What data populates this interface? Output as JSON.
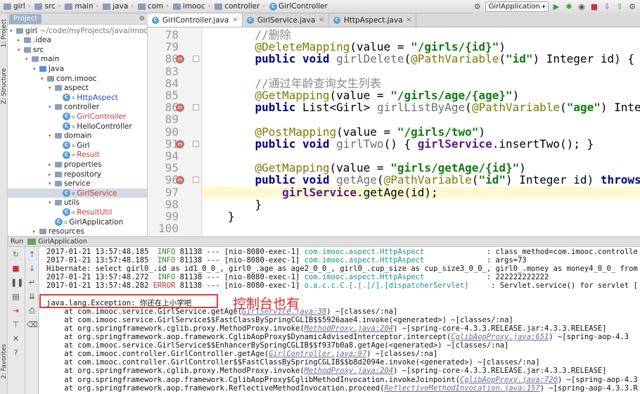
{
  "breadcrumbs": [
    "girl",
    "src",
    "main",
    "java",
    "com",
    "imooc",
    "controller",
    "GirlController"
  ],
  "run_config": "GirlApplication",
  "left_strip": {
    "project": "1: Project",
    "structure": "Z: Structure",
    "favorites": "2: Favorites"
  },
  "project_panel": {
    "tab": "Project"
  },
  "tree": [
    {
      "label": "girl",
      "suffix": "~/code/myProjects/java/imooc",
      "indent": 0,
      "arrow": "▾",
      "icon": "folder",
      "color": "",
      "sel": false
    },
    {
      "label": ".idea",
      "suffix": "",
      "indent": 1,
      "arrow": "▸",
      "icon": "folder",
      "color": "",
      "sel": false
    },
    {
      "label": "src",
      "suffix": "",
      "indent": 1,
      "arrow": "▾",
      "icon": "folder",
      "color": "",
      "sel": false
    },
    {
      "label": "main",
      "suffix": "",
      "indent": 2,
      "arrow": "▾",
      "icon": "folder",
      "color": "",
      "sel": false
    },
    {
      "label": "java",
      "suffix": "",
      "indent": 3,
      "arrow": "▾",
      "icon": "src",
      "color": "",
      "sel": false
    },
    {
      "label": "com.imooc",
      "suffix": "",
      "indent": 4,
      "arrow": "▾",
      "icon": "folder",
      "color": "",
      "sel": false
    },
    {
      "label": "aspect",
      "suffix": "",
      "indent": 5,
      "arrow": "▾",
      "icon": "folder",
      "color": "",
      "sel": false
    },
    {
      "label": "HttpAspect",
      "suffix": "",
      "indent": 6,
      "arrow": "",
      "icon": "class",
      "color": "blue",
      "sel": false
    },
    {
      "label": "controller",
      "suffix": "",
      "indent": 5,
      "arrow": "▾",
      "icon": "folder",
      "color": "",
      "sel": false
    },
    {
      "label": "GirlController",
      "suffix": "",
      "indent": 6,
      "arrow": "",
      "icon": "class",
      "color": "red",
      "sel": false
    },
    {
      "label": "HelloController",
      "suffix": "",
      "indent": 6,
      "arrow": "",
      "icon": "class",
      "color": "",
      "sel": false
    },
    {
      "label": "domain",
      "suffix": "",
      "indent": 5,
      "arrow": "▾",
      "icon": "folder",
      "color": "",
      "sel": false
    },
    {
      "label": "Girl",
      "suffix": "",
      "indent": 6,
      "arrow": "",
      "icon": "class",
      "color": "",
      "sel": false
    },
    {
      "label": "Result",
      "suffix": "",
      "indent": 6,
      "arrow": "",
      "icon": "class",
      "color": "red",
      "sel": false
    },
    {
      "label": "properties",
      "suffix": "",
      "indent": 5,
      "arrow": "▸",
      "icon": "folder",
      "color": "",
      "sel": false
    },
    {
      "label": "repository",
      "suffix": "",
      "indent": 5,
      "arrow": "▸",
      "icon": "folder",
      "color": "",
      "sel": false
    },
    {
      "label": "service",
      "suffix": "",
      "indent": 5,
      "arrow": "▾",
      "icon": "folder",
      "color": "",
      "sel": false
    },
    {
      "label": "GirlService",
      "suffix": "",
      "indent": 6,
      "arrow": "",
      "icon": "class",
      "color": "red",
      "sel": true
    },
    {
      "label": "utils",
      "suffix": "",
      "indent": 5,
      "arrow": "▾",
      "icon": "folder",
      "color": "",
      "sel": false
    },
    {
      "label": "ResultUtil",
      "suffix": "",
      "indent": 6,
      "arrow": "",
      "icon": "class",
      "color": "red",
      "sel": false
    },
    {
      "label": "GirlApplication",
      "suffix": "",
      "indent": 5,
      "arrow": "",
      "icon": "class",
      "color": "",
      "sel": false
    },
    {
      "label": "resources",
      "suffix": "",
      "indent": 3,
      "arrow": "▸",
      "icon": "folder",
      "color": "",
      "sel": false
    }
  ],
  "editor_tabs": [
    {
      "label": "GirlController.java",
      "active": true
    },
    {
      "label": "GirlService.java",
      "active": false
    },
    {
      "label": "HttpAspect.java",
      "active": false
    }
  ],
  "code_lines": [
    {
      "num": "78",
      "marker": false,
      "fold": false,
      "cur": false,
      "tokens": [
        [
          "    ",
          ""
        ],
        [
          "//删除",
          "cm"
        ]
      ]
    },
    {
      "num": "79",
      "marker": false,
      "fold": false,
      "cur": false,
      "tokens": [
        [
          "    ",
          ""
        ],
        [
          "@DeleteMapping",
          "an"
        ],
        [
          "(value = ",
          ""
        ],
        [
          "\"/girls/{id}\"",
          "st"
        ],
        [
          ")",
          ""
        ]
      ]
    },
    {
      "num": "80",
      "marker": true,
      "fold": true,
      "cur": false,
      "tokens": [
        [
          "    ",
          ""
        ],
        [
          "public void ",
          "kw"
        ],
        [
          "girlDelete",
          "fn"
        ],
        [
          "(",
          ""
        ],
        [
          "@PathVariable",
          "an"
        ],
        [
          "(",
          ""
        ],
        [
          "\"id\"",
          "st"
        ],
        [
          ") Integer id) { ",
          ""
        ],
        [
          "girlR",
          "fd"
        ]
      ]
    },
    {
      "num": "83",
      "marker": false,
      "fold": false,
      "cur": false,
      "tokens": []
    },
    {
      "num": "84",
      "marker": false,
      "fold": false,
      "cur": false,
      "tokens": [
        [
          "    ",
          ""
        ],
        [
          "//通过年龄查询女生列表",
          "cm"
        ]
      ]
    },
    {
      "num": "85",
      "marker": false,
      "fold": false,
      "cur": false,
      "tokens": [
        [
          "    ",
          ""
        ],
        [
          "@GetMapping",
          "an"
        ],
        [
          "(value = ",
          ""
        ],
        [
          "\"/girls/age/{age}\"",
          "st"
        ],
        [
          ")",
          ""
        ]
      ]
    },
    {
      "num": "86",
      "marker": true,
      "fold": true,
      "cur": false,
      "tokens": [
        [
          "    ",
          ""
        ],
        [
          "public ",
          "kw"
        ],
        [
          "List<Girl> ",
          ""
        ],
        [
          "girlListByAge",
          "fn"
        ],
        [
          "(",
          ""
        ],
        [
          "@PathVariable",
          "an"
        ],
        [
          "(",
          ""
        ],
        [
          "\"age\"",
          "st"
        ],
        [
          ") Integer a",
          ""
        ]
      ]
    },
    {
      "num": "89",
      "marker": false,
      "fold": false,
      "cur": false,
      "tokens": []
    },
    {
      "num": "90",
      "marker": false,
      "fold": false,
      "cur": false,
      "tokens": [
        [
          "    ",
          ""
        ],
        [
          "@PostMapping",
          "an"
        ],
        [
          "(value = ",
          ""
        ],
        [
          "\"/girls/two\"",
          "st"
        ],
        [
          ")",
          ""
        ]
      ]
    },
    {
      "num": "91",
      "marker": true,
      "fold": true,
      "cur": false,
      "tokens": [
        [
          "    ",
          ""
        ],
        [
          "public void ",
          "kw"
        ],
        [
          "girlTwo",
          "fn"
        ],
        [
          "() { ",
          ""
        ],
        [
          "girlService",
          "fd"
        ],
        [
          ".insertTwo(); }",
          ""
        ]
      ]
    },
    {
      "num": "94",
      "marker": false,
      "fold": false,
      "cur": false,
      "tokens": []
    },
    {
      "num": "95",
      "marker": false,
      "fold": false,
      "cur": false,
      "tokens": [
        [
          "    ",
          ""
        ],
        [
          "@GetMapping",
          "an"
        ],
        [
          "(value = ",
          ""
        ],
        [
          "\"girls/getAge/{id}\"",
          "st"
        ],
        [
          ")",
          ""
        ]
      ]
    },
    {
      "num": "96",
      "marker": true,
      "fold": true,
      "cur": false,
      "tokens": [
        [
          "    ",
          ""
        ],
        [
          "public void ",
          "kw"
        ],
        [
          "getAge",
          "fn"
        ],
        [
          "(",
          ""
        ],
        [
          "@PathVariable",
          "an"
        ],
        [
          "(",
          ""
        ],
        [
          "\"id\"",
          "st"
        ],
        [
          ") Integer id) ",
          ""
        ],
        [
          "throws ",
          "kw"
        ],
        [
          "Exce",
          ""
        ]
      ]
    },
    {
      "num": "97",
      "marker": false,
      "fold": false,
      "cur": true,
      "tokens": [
        [
          "        ",
          ""
        ],
        [
          "girlService",
          "fd"
        ],
        [
          ".getAge(id);",
          ""
        ]
      ]
    },
    {
      "num": "98",
      "marker": false,
      "fold": false,
      "cur": false,
      "tokens": [
        [
          "    }",
          ""
        ]
      ]
    },
    {
      "num": "99",
      "marker": false,
      "fold": false,
      "cur": false,
      "tokens": [
        [
          "}",
          ""
        ]
      ]
    },
    {
      "num": "100",
      "marker": false,
      "fold": false,
      "cur": false,
      "tokens": []
    }
  ],
  "run_panel": {
    "label": "Run",
    "app": "GirlApplication"
  },
  "log_lines": [
    [
      [
        "2017-01-21 13:57:48.185  ",
        ""
      ],
      [
        "INFO",
        "info"
      ],
      [
        " 81138 --- [nio-8080-exec-1] ",
        ""
      ],
      [
        "com.imooc.aspect.HttpAspect",
        "cls"
      ],
      [
        "              : class_method=com.imooc.controlle",
        ""
      ]
    ],
    [
      [
        "2017-01-21 13:57:48.185  ",
        ""
      ],
      [
        "INFO",
        "info"
      ],
      [
        " 81138 --- [nio-8080-exec-1] ",
        ""
      ],
      [
        "com.imooc.aspect.HttpAspect",
        "cls"
      ],
      [
        "              : args=73",
        ""
      ]
    ],
    [
      [
        "Hibernate: select girl0_.id as id1_0_0_, girl0_.age as age2_0_0_, girl0_.cup_size as cup_size3_0_0_, girl0_.money as money4_0_0_ from",
        ""
      ]
    ],
    [
      [
        "2017-01-21 13:57:48.272  ",
        ""
      ],
      [
        "INFO",
        "info"
      ],
      [
        " 81138 --- [nio-8080-exec-1] ",
        ""
      ],
      [
        "com.imooc.aspect.HttpAspect",
        "cls"
      ],
      [
        "              : 222222222222",
        ""
      ]
    ],
    [
      [
        "2017-01-21 13:57:48.282 ",
        ""
      ],
      [
        "ERROR",
        "err"
      ],
      [
        " 81138 --- [nio-8080-exec-1] ",
        ""
      ],
      [
        "o.a.c.c.C.[.[.[/].[dispatcherServlet]",
        "cls"
      ],
      [
        "     : Servlet.service() for servlet [",
        ""
      ]
    ],
    [],
    [
      [
        "java.lang.Exception: 你还在上小学吧",
        ""
      ]
    ],
    [
      [
        "    at com.imooc.service.GirlService.getAge(",
        ""
      ],
      [
        "GirlService.java:38",
        "lnk"
      ],
      [
        ") ~[classes/:na]",
        ""
      ]
    ],
    [
      [
        "    at com.imooc.service.GirlService$$FastClassBySpringCGLIB$$5926aae4.invoke(<generated>) ~[classes/:na]",
        ""
      ]
    ],
    [
      [
        "    at org.springframework.cglib.proxy.MethodProxy.invoke(",
        ""
      ],
      [
        "MethodProxy.java:204",
        "lnk"
      ],
      [
        ") ~[spring-core-4.3.3.RELEASE.jar:4.3.3.RELEASE]",
        ""
      ]
    ],
    [
      [
        "    at org.springframework.aop.framework.CglibAopProxy$DynamicAdvisedInterceptor.intercept(",
        ""
      ],
      [
        "CglibAopProxy.java:651",
        "lnk"
      ],
      [
        ") ~[spring-aop-4.3",
        ""
      ]
    ],
    [
      [
        "    at com.imooc.service.GirlService$$EnhancerBySpringCGLIB$$f937b0a8.getAge(<generated>) ~[classes/:na]",
        ""
      ]
    ],
    [
      [
        "    at com.imooc.controller.GirlController.getAge(",
        ""
      ],
      [
        "GirlController.java:97",
        "lnk"
      ],
      [
        ") ~[classes/:na]",
        ""
      ]
    ],
    [
      [
        "    at com.imooc.controller.GirlController$$FastClassBySpringCGLIB$$b8d2094e.invoke(<generated>) ~[classes/:na]",
        ""
      ]
    ],
    [
      [
        "    at org.springframework.cglib.proxy.MethodProxy.invoke(",
        ""
      ],
      [
        "MethodProxy.java:204",
        "lnk"
      ],
      [
        ") ~[spring-core-4.3.3.RELEASE.jar:4.3.3.RELEASE]",
        ""
      ]
    ],
    [
      [
        "    at org.springframework.aop.framework.CglibAopProxy$CglibMethodInvocation.invokeJoinpoint(",
        ""
      ],
      [
        "CglibAopProxy.java:720",
        "lnk"
      ],
      [
        ") ~[spring-aop-4.3",
        ""
      ]
    ],
    [
      [
        "    at org.springframework.aop.framework.ReflectiveMethodInvocation.proceed(",
        ""
      ],
      [
        "ReflectiveMethodInvocation.java:157",
        "lnk"
      ],
      [
        ") ~[spring-aop-4.3.3.R",
        ""
      ]
    ]
  ],
  "annotation": "控制台也有",
  "colors": {
    "annotation": "#e02525",
    "error": "#d03030",
    "info": "#2a8a2a",
    "current_line": "#fff9d3"
  }
}
